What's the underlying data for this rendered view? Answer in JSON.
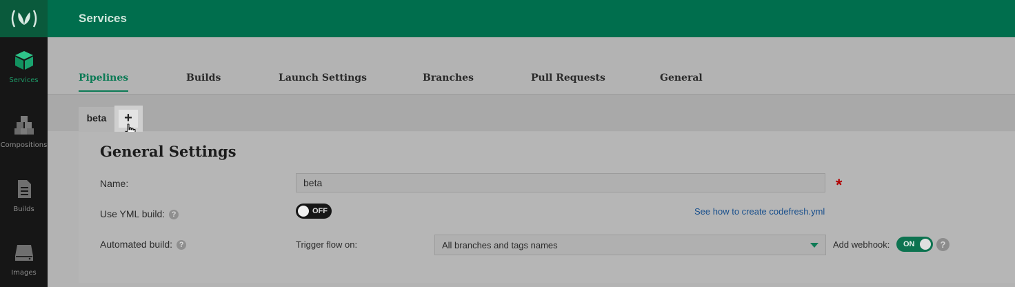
{
  "header": {
    "title": "Services"
  },
  "sidebar": {
    "items": [
      {
        "label": "Services",
        "icon": "cube-icon",
        "active": true
      },
      {
        "label": "Compositions",
        "icon": "cubes-icon"
      },
      {
        "label": "Builds",
        "icon": "document-icon"
      },
      {
        "label": "Images",
        "icon": "drive-icon"
      }
    ]
  },
  "tabs": [
    {
      "label": "Pipelines",
      "active": true
    },
    {
      "label": "Builds"
    },
    {
      "label": "Launch Settings"
    },
    {
      "label": "Branches"
    },
    {
      "label": "Pull Requests"
    },
    {
      "label": "General"
    }
  ],
  "pipeline_tabs": {
    "active": "beta",
    "add_label": "+"
  },
  "general": {
    "heading": "General Settings",
    "name_label": "Name:",
    "name_value": "beta",
    "required_mark": "*",
    "yml_label": "Use YML build:",
    "yml_toggle": "OFF",
    "yml_link": "See how to create codefresh.yml",
    "auto_label": "Automated build:",
    "trigger_label": "Trigger flow on:",
    "trigger_value": "All branches and tags names",
    "webhook_label": "Add webhook:",
    "webhook_toggle": "ON",
    "help_glyph": "?"
  },
  "colors": {
    "brand": "#006e4d",
    "accent": "#0b7a55",
    "required": "#b10000",
    "link": "#184f8c"
  }
}
